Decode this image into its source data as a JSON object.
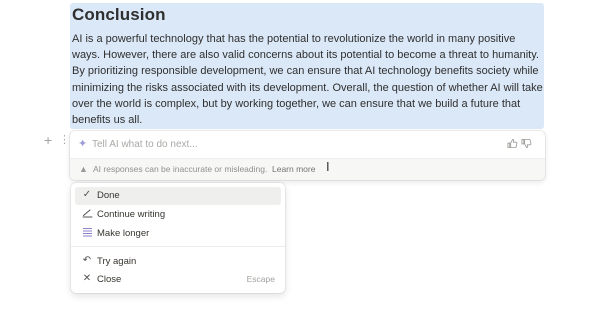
{
  "document": {
    "heading": "Conclusion",
    "paragraph": "AI is a powerful technology that has the potential to revolutionize the world in many positive ways. However, there are also valid concerns about its potential to become a threat to humanity. By prioritizing responsible development, we can ensure that AI technology benefits society while minimizing the risks associated with its development. Overall, the question of whether AI will take over the world is complex, but by working together, we can ensure that we build a future that benefits us all."
  },
  "ai_prompt": {
    "placeholder": "Tell AI what to do next...",
    "value": "",
    "disclaimer": "AI responses can be inaccurate or misleading.",
    "learn_more": "Learn more"
  },
  "menu": {
    "primary": [
      {
        "label": "Done",
        "icon": "check-icon",
        "active": true
      },
      {
        "label": "Continue writing",
        "icon": "pen-icon",
        "active": false
      },
      {
        "label": "Make longer",
        "icon": "lines-icon",
        "active": false
      }
    ],
    "secondary": [
      {
        "label": "Try again",
        "icon": "undo-icon",
        "shortcut": ""
      },
      {
        "label": "Close",
        "icon": "close-icon",
        "shortcut": "Escape"
      }
    ]
  },
  "colors": {
    "selection": "#dbe8f7",
    "accent_sparkle": "#9a9cd6",
    "menu_active": "#efefed"
  }
}
